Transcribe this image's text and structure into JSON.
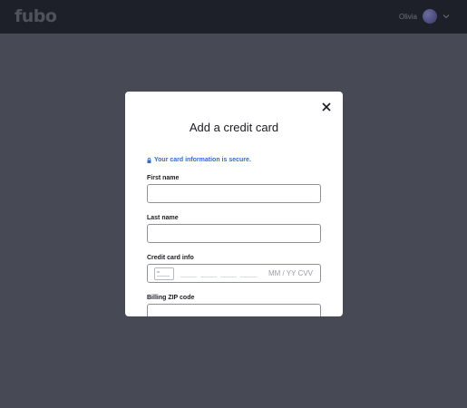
{
  "header": {
    "logo_text": "fubo",
    "user_name": "Olivia"
  },
  "modal": {
    "title": "Add a credit card",
    "secure_note": "Your card information is secure.",
    "fields": {
      "first_name_label": "First name",
      "last_name_label": "Last name",
      "credit_card_label": "Credit card info",
      "credit_card_placeholder": "MM / YY CVV",
      "zip_label": "Billing ZIP code"
    }
  },
  "colors": {
    "accent": "#2e6bd8",
    "overlay": "#474a55",
    "topbar": "#1e2029"
  }
}
